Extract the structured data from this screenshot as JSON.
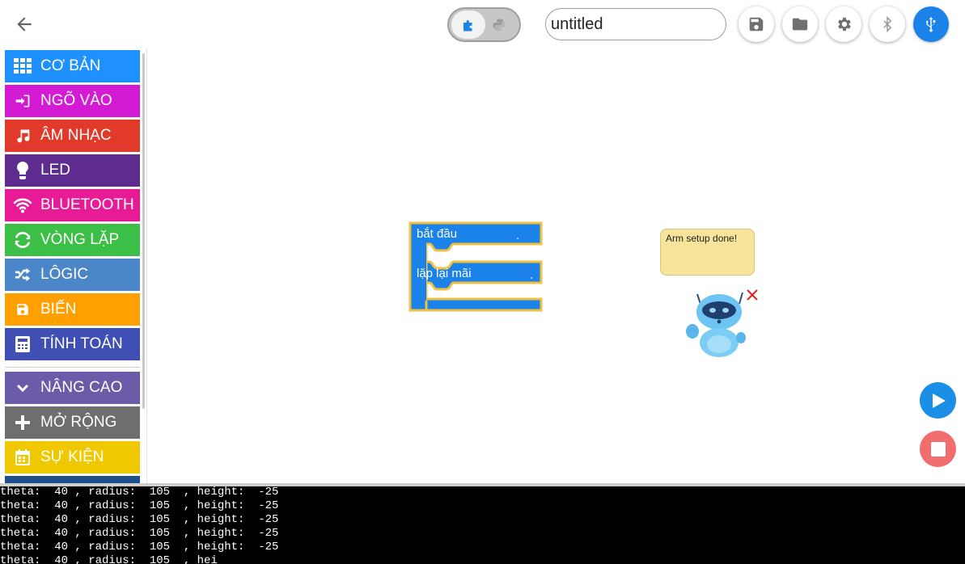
{
  "header": {
    "back_icon": "arrow-left-icon",
    "mode_toggle": {
      "active": "blocks-icon",
      "inactive": "python-icon"
    },
    "project_name": "untitled",
    "buttons": [
      {
        "name": "save-button",
        "icon": "save-icon"
      },
      {
        "name": "open-folder-button",
        "icon": "folder-icon"
      },
      {
        "name": "settings-button",
        "icon": "gear-icon"
      },
      {
        "name": "bluetooth-button",
        "icon": "bluetooth-icon"
      },
      {
        "name": "usb-button",
        "icon": "usb-icon"
      }
    ]
  },
  "sidebar": {
    "categories": [
      {
        "label": "CƠ BẢN",
        "icon": "grid-icon",
        "color": "#1e90ff"
      },
      {
        "label": "NGÕ VÀO",
        "icon": "input-icon",
        "color": "#d41bd4"
      },
      {
        "label": "ÂM NHẠC",
        "icon": "music-icon",
        "color": "#e13a2a"
      },
      {
        "label": "LED",
        "icon": "lightbulb-icon",
        "color": "#5e2c8f"
      },
      {
        "label": "BLUETOOTH",
        "icon": "wifi-icon",
        "color": "#e81b96"
      },
      {
        "label": "VÒNG LẶP",
        "icon": "loop-icon",
        "color": "#3cbf46"
      },
      {
        "label": "LÔGIC",
        "icon": "shuffle-icon",
        "color": "#4a86c8"
      },
      {
        "label": "BIẾN",
        "icon": "variable-icon",
        "color": "#ff9f00"
      },
      {
        "label": "TÍNH TOÁN",
        "icon": "calculator-icon",
        "color": "#3f4fb3"
      }
    ],
    "extra": [
      {
        "label": "NÂNG CAO",
        "icon": "chevron-down-icon",
        "color": "#6b5ba8"
      },
      {
        "label": "MỞ RỘNG",
        "icon": "plus-icon",
        "color": "#6e6e6e"
      },
      {
        "label": "SỰ KIỆN",
        "icon": "calendar-icon",
        "color": "#f0c800"
      }
    ]
  },
  "workspace": {
    "blocks": [
      {
        "label": "bắt đầu",
        "color": "#1a82e8",
        "border": "#f0c040"
      },
      {
        "label": "lặp lại mãi",
        "color": "#1a82e8",
        "border": "#f0c040"
      }
    ],
    "assistant": {
      "message": "Arm setup done!",
      "icon": "robot-icon",
      "close_icon": "close-icon"
    },
    "run_icon": "play-icon",
    "stop_icon": "stop-icon"
  },
  "console": {
    "lines": [
      "theta:  40 , radius:  105  , height:  -25",
      "theta:  40 , radius:  105  , height:  -25",
      "theta:  40 , radius:  105  , height:  -25",
      "theta:  40 , radius:  105  , height:  -25",
      "theta:  40 , radius:  105  , height:  -25",
      "theta:  40 , radius:  105  , hei"
    ]
  }
}
